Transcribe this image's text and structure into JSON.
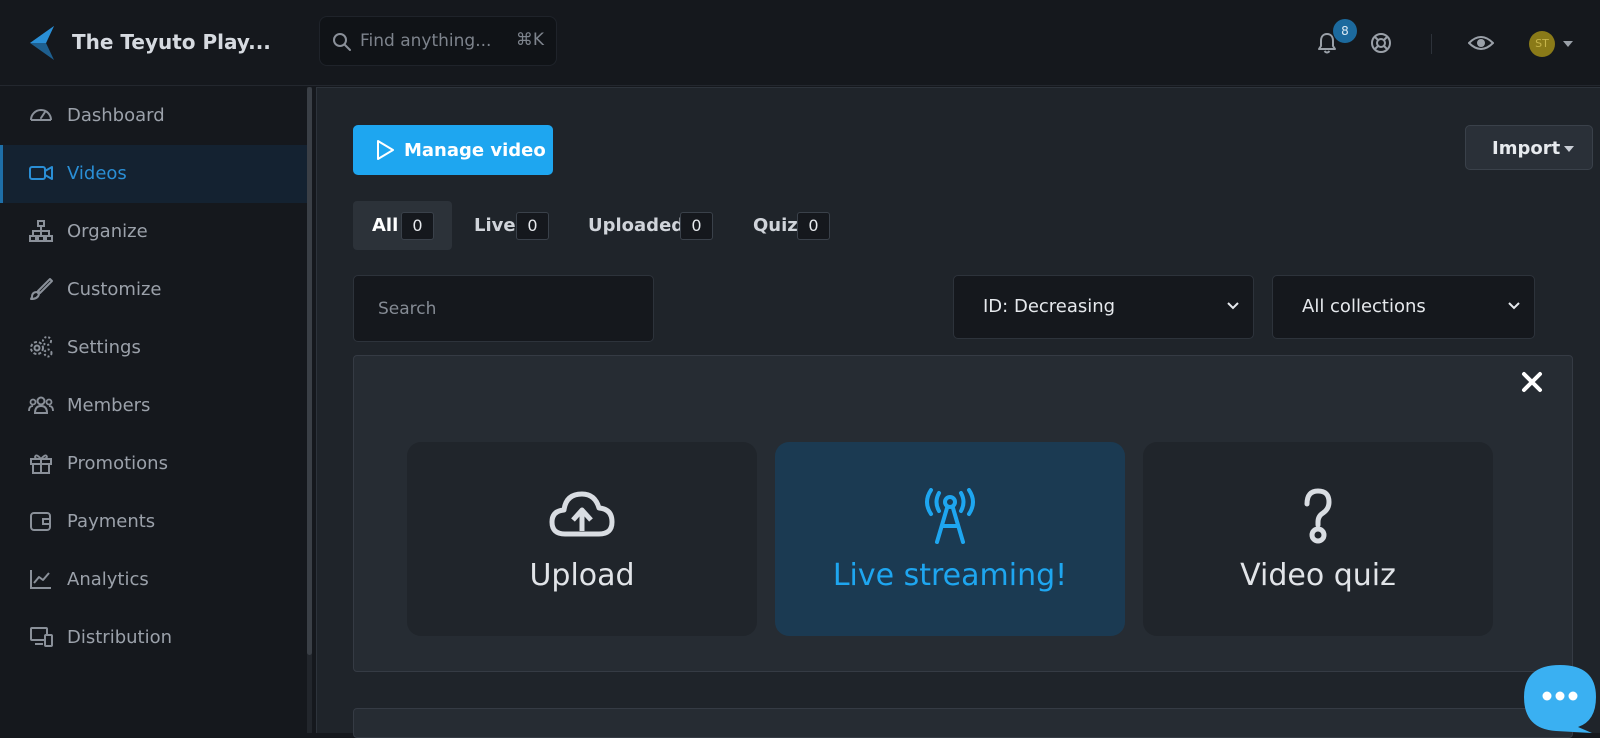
{
  "app": {
    "title": "The Teyuto Play..."
  },
  "header": {
    "search_placeholder": "Find anything...",
    "search_shortcut": "⌘K",
    "notification_count": "8",
    "avatar_initials": "ST",
    "icons": [
      "search-icon",
      "bell-icon",
      "help-icon",
      "eye-icon",
      "chevron-down-icon"
    ]
  },
  "sidebar": {
    "items": [
      {
        "label": "Dashboard",
        "icon": "dashboard-icon"
      },
      {
        "label": "Videos",
        "icon": "video-icon",
        "active": true
      },
      {
        "label": "Organize",
        "icon": "sitemap-icon"
      },
      {
        "label": "Customize",
        "icon": "brush-icon"
      },
      {
        "label": "Settings",
        "icon": "gears-icon"
      },
      {
        "label": "Members",
        "icon": "users-icon"
      },
      {
        "label": "Promotions",
        "icon": "gift-icon"
      },
      {
        "label": "Payments",
        "icon": "wallet-icon"
      },
      {
        "label": "Analytics",
        "icon": "chart-line-icon"
      },
      {
        "label": "Distribution",
        "icon": "devices-icon"
      }
    ]
  },
  "toolbar": {
    "manage_label": "Manage video",
    "import_label": "Import"
  },
  "tabs": [
    {
      "label": "All",
      "count": "0",
      "active": true
    },
    {
      "label": "Live",
      "count": "0"
    },
    {
      "label": "Uploaded",
      "count": "0"
    },
    {
      "label": "Quiz",
      "count": "0"
    }
  ],
  "filters": {
    "search_placeholder": "Search",
    "sort_value": "ID: Decreasing",
    "collection_value": "All collections"
  },
  "create_panel": {
    "cards": [
      {
        "label": "Upload",
        "icon": "cloud-upload-icon"
      },
      {
        "label": "Live streaming!",
        "icon": "broadcast-tower-icon",
        "active": true
      },
      {
        "label": "Video quiz",
        "icon": "question-icon"
      }
    ]
  },
  "colors": {
    "accent": "#1ea6f0",
    "background": "#15181d",
    "panel": "#262c33",
    "active_card": "#1b3a52"
  }
}
